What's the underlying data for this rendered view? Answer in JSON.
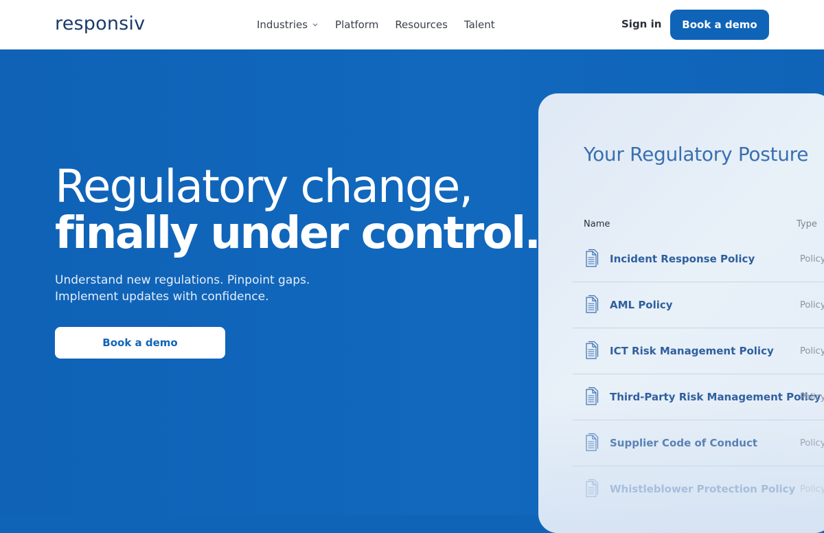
{
  "header": {
    "logo": "responsiv",
    "nav": [
      {
        "label": "Industries",
        "has_dropdown": true
      },
      {
        "label": "Platform",
        "has_dropdown": false
      },
      {
        "label": "Resources",
        "has_dropdown": false
      },
      {
        "label": "Talent",
        "has_dropdown": false
      }
    ],
    "sign_in": "Sign in",
    "cta": "Book a demo"
  },
  "hero": {
    "headline_line1": "Regulatory change,",
    "headline_line2": "finally under control.",
    "subtitle_line1": "Understand new regulations. Pinpoint gaps.",
    "subtitle_line2": "Implement updates with confidence.",
    "cta": "Book a demo"
  },
  "card": {
    "title": "Your Regulatory Posture",
    "columns": {
      "name": "Name",
      "type": "Type"
    },
    "rows": [
      {
        "name": "Incident Response Policy",
        "type": "Policy"
      },
      {
        "name": "AML Policy",
        "type": "Policy"
      },
      {
        "name": "ICT Risk Management Policy",
        "type": "Policy"
      },
      {
        "name": "Third-Party Risk Management Policy",
        "type": "Policy"
      },
      {
        "name": "Supplier Code of Conduct",
        "type": "Policy"
      },
      {
        "name": "Whistleblower Protection Policy",
        "type": "Policy"
      }
    ]
  },
  "colors": {
    "brand_blue": "#1064b8",
    "logo_navy": "#1b3a6b",
    "card_text_blue": "#2f5f9e"
  },
  "icons": {
    "row_icon": "document-icon",
    "dropdown": "chevron-down-icon"
  }
}
